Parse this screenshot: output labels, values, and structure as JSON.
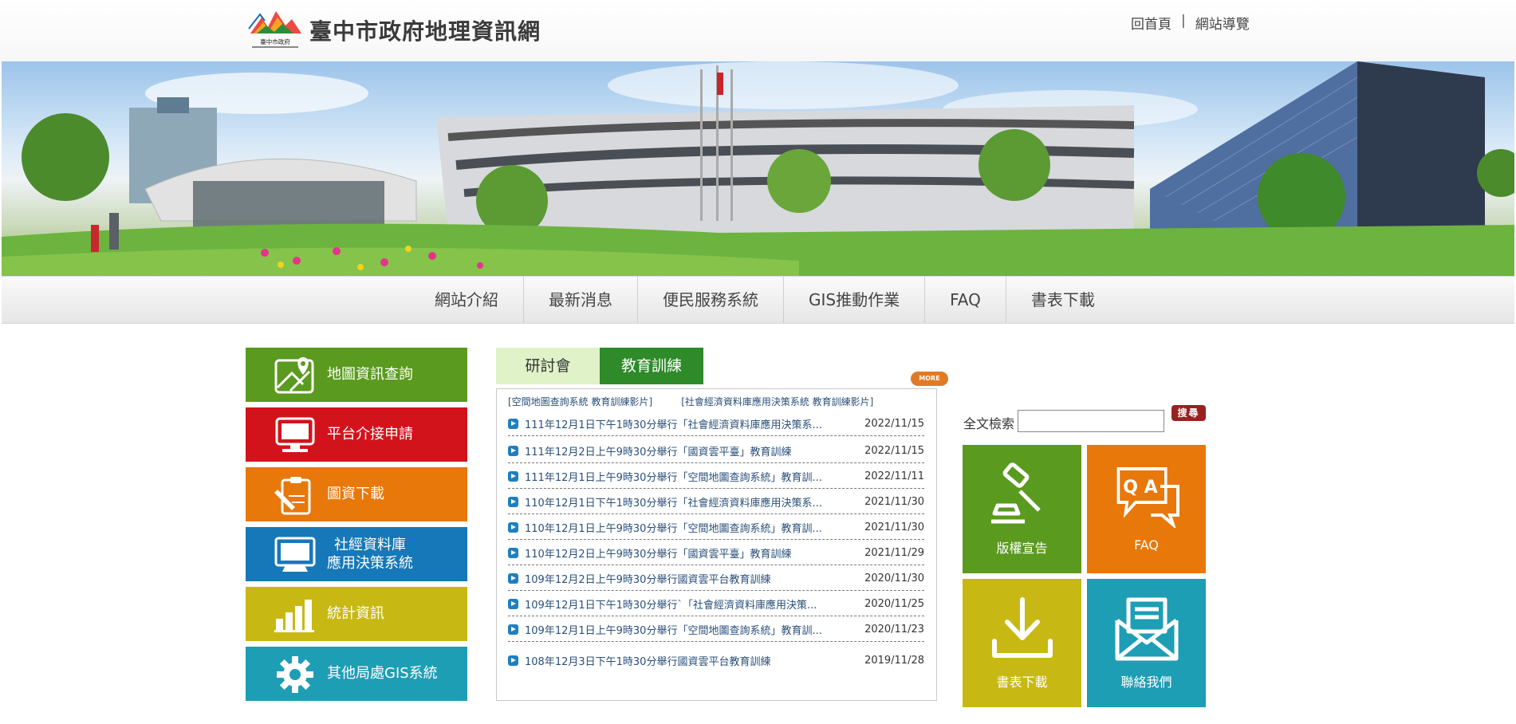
{
  "header": {
    "logo_text": "臺中市政府",
    "site_title": "臺中市政府地理資訊網",
    "links": [
      "回首頁",
      "網站導覽"
    ],
    "separator": "|"
  },
  "nav": {
    "items": [
      "網站介紹",
      "最新消息",
      "便民服務系統",
      "GIS推動作業",
      "FAQ",
      "書表下載"
    ]
  },
  "left_menu": {
    "items": [
      {
        "label": "地圖資訊查詢",
        "icon": "map-pin-icon",
        "color": "#5a9a1e"
      },
      {
        "label": "平台介接申請",
        "icon": "monitor-icon",
        "color": "#d3131c"
      },
      {
        "label": "圖資下載",
        "icon": "clipboard-pen-icon",
        "color": "#e8780a"
      },
      {
        "label": "社經資料庫",
        "label2": "應用決策系統",
        "icon": "computer-icon",
        "color": "#1678b8"
      },
      {
        "label": "統計資訊",
        "icon": "bar-chart-icon",
        "color": "#c8b814"
      },
      {
        "label": "其他局處GIS系統",
        "icon": "gear-icon",
        "color": "#1d9eb5"
      }
    ]
  },
  "news": {
    "tabs": [
      "研討會",
      "教育訓練"
    ],
    "more_label": "MORE",
    "video_links": [
      "[空間地圖查詢系統 教育訓練影片]",
      "[社會經濟資料庫應用決策系統 教育訓練影片]"
    ],
    "rows": [
      {
        "title": "111年12月1日下午1時30分舉行「社會經濟資料庫應用決策系...",
        "date": "2022/11/15"
      },
      {
        "title": "111年12月2日上午9時30分舉行「國資雲平臺」教育訓練",
        "date": "2022/11/15"
      },
      {
        "title": "111年12月1日上午9時30分舉行「空間地圖查詢系統」教育訓...",
        "date": "2022/11/11"
      },
      {
        "title": "110年12月1日下午1時30分舉行「社會經濟資料庫應用決策系...",
        "date": "2021/11/30"
      },
      {
        "title": "110年12月1日上午9時30分舉行「空間地圖查詢系統」教育訓...",
        "date": "2021/11/30"
      },
      {
        "title": "110年12月2日上午9時30分舉行「國資雲平臺」教育訓練",
        "date": "2021/11/29"
      },
      {
        "title": "109年12月2日上午9時30分舉行國資雲平台教育訓練",
        "date": "2020/11/30"
      },
      {
        "title": "109年12月1日下午1時30分舉行`「社會經濟資料庫應用決策...",
        "date": "2020/11/25"
      },
      {
        "title": "109年12月1日上午9時30分舉行「空間地圖查詢系統」教育訓...",
        "date": "2020/11/23"
      },
      {
        "title": "108年12月3日下午1時30分舉行國資雲平台教育訓練",
        "date": "2019/11/28"
      }
    ]
  },
  "search": {
    "label": "全文檢索",
    "value": "",
    "button_label": "搜尋"
  },
  "tiles": [
    {
      "label": "版權宣告",
      "icon": "gavel-icon",
      "color": "#5a9a1e"
    },
    {
      "label": "FAQ",
      "icon": "qa-chat-icon",
      "color": "#e8780a",
      "icon_text": "Q A"
    },
    {
      "label": "書表下載",
      "icon": "download-icon",
      "color": "#c8b814"
    },
    {
      "label": "聯絡我們",
      "icon": "mail-icon",
      "color": "#1d9eb5"
    }
  ]
}
